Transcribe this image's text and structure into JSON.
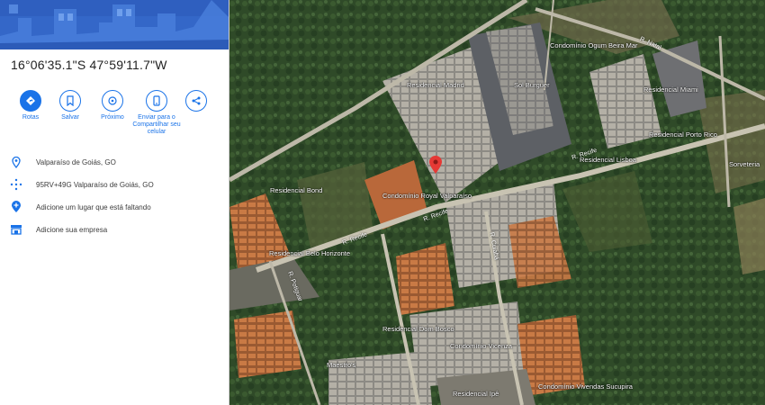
{
  "panel": {
    "coordinates": "16°06'35.1\"S 47°59'11.7\"W",
    "actions": [
      {
        "label": "Rotas",
        "icon": "directions-icon"
      },
      {
        "label": "Salvar",
        "icon": "bookmark-icon"
      },
      {
        "label": "Próximo",
        "icon": "nearby-icon"
      },
      {
        "label": "Enviar para o Compartilhar seu celular",
        "icon": "send-to-phone-icon"
      },
      {
        "label": "",
        "icon": "share-icon"
      }
    ],
    "info": [
      {
        "text": "Valparaíso de Goiás, GO",
        "icon": "location-pin-icon"
      },
      {
        "text": "95RV+49G Valparaíso de Goiás, GO",
        "icon": "plus-code-icon"
      },
      {
        "text": "Adicione um lugar que está faltando",
        "icon": "add-place-icon"
      },
      {
        "text": "Adicione sua empresa",
        "icon": "add-business-icon"
      }
    ]
  },
  "map": {
    "pois": [
      {
        "label": "Condomínio Ogum Beira Mar",
        "kind": "poi"
      },
      {
        "label": "Sol Burguer",
        "kind": "food"
      },
      {
        "label": "Residencial Madrid",
        "kind": "poi"
      },
      {
        "label": "Residencial Miami",
        "kind": "poi"
      },
      {
        "label": "Residencial Porto Rico",
        "kind": "poi"
      },
      {
        "label": "Residencial Lisboa",
        "kind": "poi"
      },
      {
        "label": "Sorveteria",
        "kind": "food"
      },
      {
        "label": "Residencial Bond",
        "kind": "poi"
      },
      {
        "label": "Condomínio Royal Valparaíso",
        "kind": "poi"
      },
      {
        "label": "Residencial Belo Horizonte",
        "kind": "poi"
      },
      {
        "label": "Residencial Dom Bosco",
        "kind": "poi"
      },
      {
        "label": "Condomínio Vicenza",
        "kind": "poi"
      },
      {
        "label": "Maestro's",
        "kind": "poi"
      },
      {
        "label": "Condomínio Vivendas Sucupira",
        "kind": "poi"
      },
      {
        "label": "Residencial Ipê",
        "kind": "poi"
      }
    ],
    "roads": [
      "R. Recife",
      "R. Recife",
      "R. Recife",
      "R. Potiguar",
      "R. Natal",
      "R. Cuiabá"
    ]
  }
}
